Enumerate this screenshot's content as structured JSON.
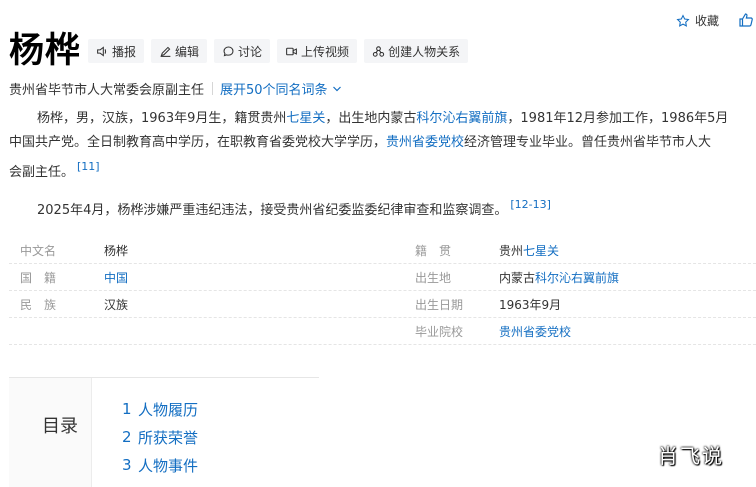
{
  "header": {
    "title": "杨桦",
    "actions": [
      {
        "label": "播报",
        "icon": "speaker-icon"
      },
      {
        "label": "编辑",
        "icon": "pencil-icon"
      },
      {
        "label": "讨论",
        "icon": "chat-icon"
      },
      {
        "label": "上传视频",
        "icon": "video-icon"
      },
      {
        "label": "创建人物关系",
        "icon": "relation-icon"
      }
    ],
    "collect_label": "收藏",
    "subtitle": "贵州省毕节市人大常委会原副主任",
    "expand_label": "展开50个同名词条"
  },
  "summary": {
    "p1": {
      "t1": "杨桦，男，汉族，1963年9月生，籍贯贵州",
      "l1": "七星关",
      "t2": "，出生地内蒙古",
      "l2": "科尔沁右翼前旗",
      "t3": "，1981年12月参加工作，1986年5月",
      "t4": "中国共产党。全日制教育高中学历，在职教育省委党校大学学历，",
      "l3": "贵州省委党校",
      "t5": "经济管理专业毕业。曾任贵州省毕节市人大",
      "t6": "会副主任。",
      "ref": "[11]"
    },
    "p2": {
      "text": "2025年4月，杨桦涉嫌严重违纪违法，接受贵州省纪委监委纪律审查和监察调查。",
      "ref": "[12-13]"
    }
  },
  "info": {
    "left": [
      {
        "name": "中文名",
        "value": "杨桦",
        "link": false
      },
      {
        "name": "国　籍",
        "value": "中国",
        "link": true
      },
      {
        "name": "民　族",
        "value": "汉族",
        "link": false
      },
      {
        "name": "",
        "value": "",
        "link": false
      }
    ],
    "right": [
      {
        "name": "籍　贯",
        "prefix": "贵州",
        "value": "七星关",
        "link": true
      },
      {
        "name": "出生地",
        "prefix": "内蒙古",
        "value": "科尔沁右翼前旗",
        "link": true
      },
      {
        "name": "出生日期",
        "prefix": "",
        "value": "1963年9月",
        "link": false
      },
      {
        "name": "毕业院校",
        "prefix": "",
        "value": "贵州省委党校",
        "link": true
      }
    ]
  },
  "toc": {
    "title": "目录",
    "items": [
      {
        "num": "1",
        "label": "人物履历"
      },
      {
        "num": "2",
        "label": "所获荣誉"
      },
      {
        "num": "3",
        "label": "人物事件"
      }
    ]
  },
  "watermark": "肖飞说",
  "colors": {
    "link": "#136ec2",
    "text": "#333333",
    "muted": "#999999"
  }
}
